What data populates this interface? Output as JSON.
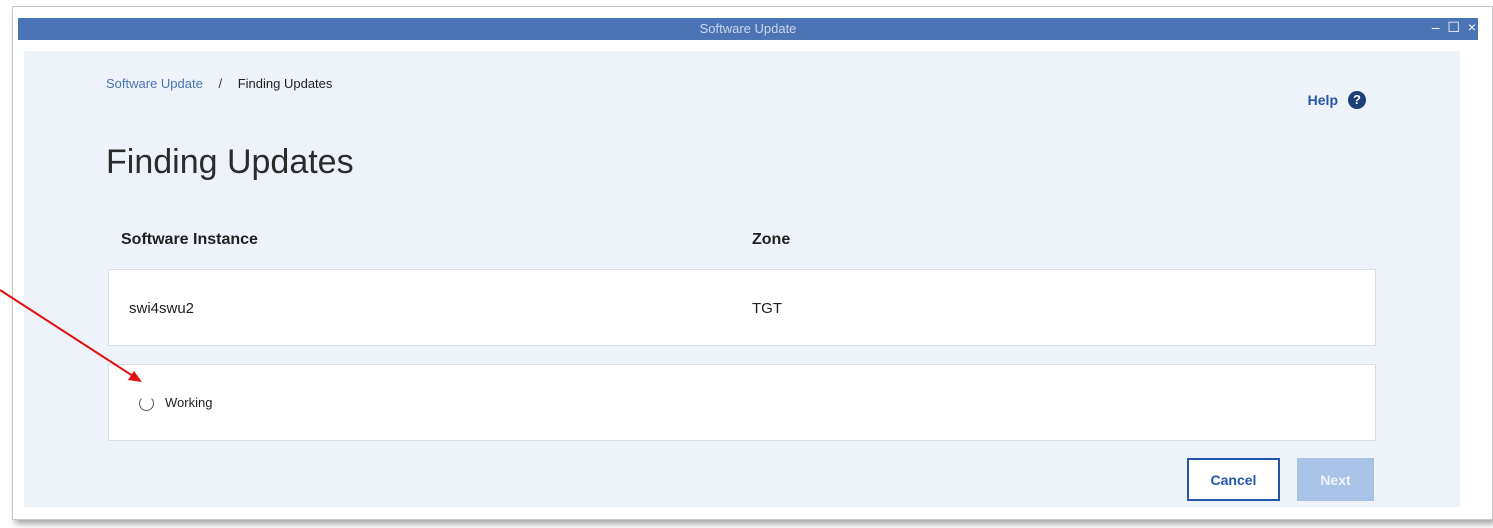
{
  "window": {
    "title": "Software Update",
    "controls": "– ☐ ×"
  },
  "breadcrumb": {
    "parent": "Software Update",
    "separator": "/",
    "current": "Finding Updates"
  },
  "help": {
    "label": "Help",
    "icon": "?"
  },
  "page_title": "Finding Updates",
  "table": {
    "columns": [
      "Software Instance",
      "Zone"
    ],
    "rows": [
      {
        "instance": "swi4swu2",
        "zone": "TGT"
      }
    ]
  },
  "status": {
    "text": "Working"
  },
  "buttons": {
    "cancel": "Cancel",
    "next": "Next"
  },
  "colors": {
    "titlebar": "#4a74b4",
    "dialog_bg": "#eef3fa",
    "link": "#2457a8",
    "next_disabled": "#a9c3e6",
    "annotation_arrow": "#e01010"
  }
}
